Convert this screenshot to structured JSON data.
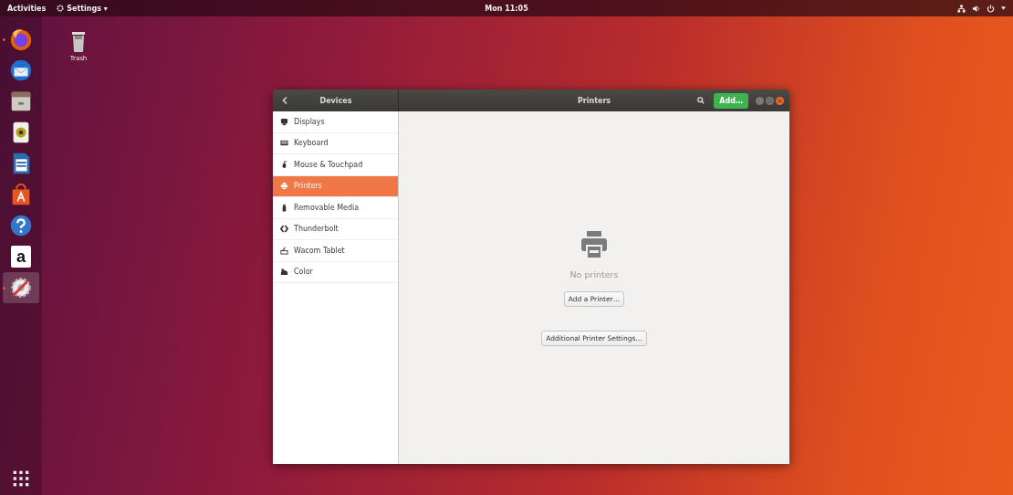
{
  "top_bar": {
    "activities": "Activities",
    "app_menu": "Settings ▾",
    "clock": "Mon 11:05"
  },
  "dock": [
    {
      "running": true,
      "focused": false
    },
    {
      "running": false,
      "focused": false
    },
    {
      "running": false,
      "focused": false
    },
    {
      "running": false,
      "focused": false
    },
    {
      "running": false,
      "focused": false
    },
    {
      "running": false,
      "focused": false
    },
    {
      "running": false,
      "focused": false
    },
    {
      "running": false,
      "focused": false,
      "label": "a"
    },
    {
      "running": true,
      "focused": true
    }
  ],
  "desktop_icons": [
    {
      "label": "Trash"
    }
  ],
  "window": {
    "sidebar_title": "Devices",
    "title": "Printers",
    "add_button": "Add…",
    "sidebar": [
      {
        "label": "Displays",
        "selected": false
      },
      {
        "label": "Keyboard",
        "selected": false
      },
      {
        "label": "Mouse & Touchpad",
        "selected": false
      },
      {
        "label": "Printers",
        "selected": true
      },
      {
        "label": "Removable Media",
        "selected": false
      },
      {
        "label": "Thunderbolt",
        "selected": false
      },
      {
        "label": "Wacom Tablet",
        "selected": false
      },
      {
        "label": "Color",
        "selected": false
      }
    ],
    "empty_message": "No printers",
    "buttons": [
      "Add a Printer…",
      "Additional Printer Settings…"
    ]
  }
}
